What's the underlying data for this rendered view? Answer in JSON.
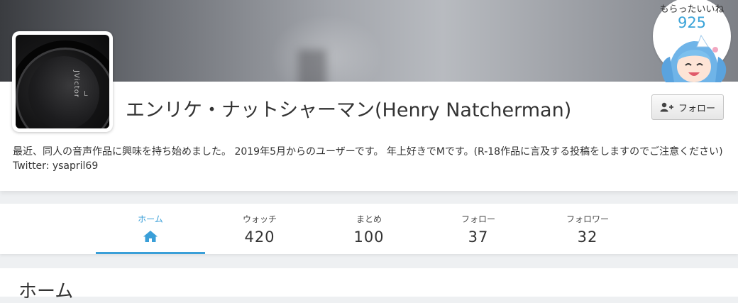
{
  "profile": {
    "name": "エンリケ・ナットシャーマン(Henry Natcherman)",
    "bio": "最近、同人の音声作品に興味を持ち始めました。 2019年5月からのユーザーです。 年上好きでMです。(R-18作品に言及する投稿をしますのでご注意ください) Twitter: ysapril69",
    "follow_label": "フォロー",
    "follow_icon": "user-plus-icon",
    "avatar_brand_text": "JVictor",
    "avatar_mark": "L"
  },
  "likes": {
    "label": "もらったいいね",
    "count": "925"
  },
  "tabs": [
    {
      "label": "ホーム",
      "icon": "home-icon",
      "active": true
    },
    {
      "label": "ウォッチ",
      "value": "420"
    },
    {
      "label": "まとめ",
      "value": "100"
    },
    {
      "label": "フォロー",
      "value": "37"
    },
    {
      "label": "フォロワー",
      "value": "32"
    }
  ],
  "section": {
    "title": "ホーム"
  },
  "colors": {
    "accent": "#3a9fd8",
    "text": "#333333"
  }
}
